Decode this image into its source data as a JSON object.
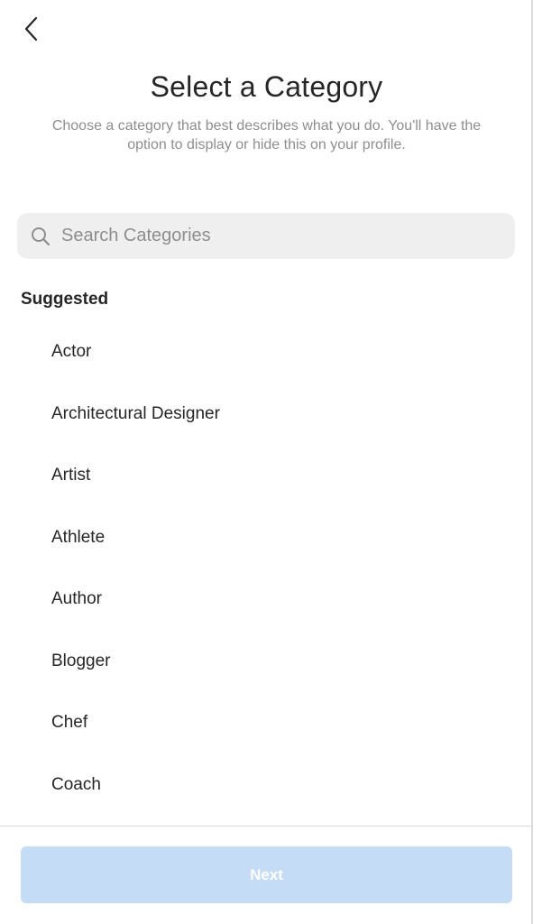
{
  "header": {
    "back_icon": "chevron-left-icon",
    "title": "Select a Category",
    "subtitle": "Choose a category that best describes what you do. You'll have the option to display or hide this on your profile."
  },
  "search": {
    "icon": "search-icon",
    "placeholder": "Search Categories",
    "value": ""
  },
  "suggested": {
    "heading": "Suggested",
    "items": [
      {
        "label": "Actor"
      },
      {
        "label": "Architectural Designer"
      },
      {
        "label": "Artist"
      },
      {
        "label": "Athlete"
      },
      {
        "label": "Author"
      },
      {
        "label": "Blogger"
      },
      {
        "label": "Chef"
      },
      {
        "label": "Coach"
      }
    ]
  },
  "footer": {
    "next_label": "Next",
    "next_state": "disabled"
  },
  "colors": {
    "text": "#262626",
    "secondary_text": "#8e8e8e",
    "search_bg": "#efefef",
    "button_disabled_bg": "#c4dcf5",
    "divider": "#dbdbdb"
  }
}
